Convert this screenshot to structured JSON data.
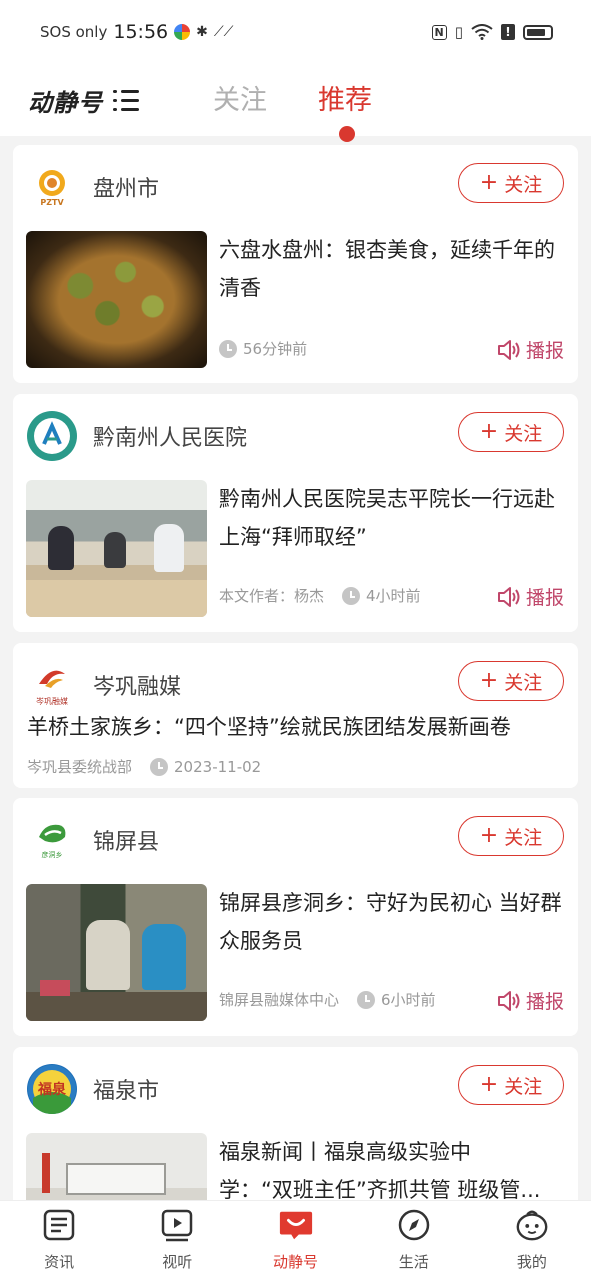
{
  "status_bar": {
    "carrier": "SOS only",
    "time": "15:56",
    "right_icons": [
      "nfc-icon",
      "vibrate-icon",
      "wifi-icon",
      "alert-icon",
      "battery-icon"
    ]
  },
  "header": {
    "brand": "动静号",
    "tabs": [
      {
        "label": "关注",
        "active": false
      },
      {
        "label": "推荐",
        "active": true
      }
    ]
  },
  "follow_label": "关注",
  "broadcast_label": "播报",
  "cards": [
    {
      "source": "盘州市",
      "title": "六盘水盘州：银杏美食，延续千年的清香",
      "time": "56分钟前",
      "has_broadcast": true
    },
    {
      "source": "黔南州人民医院",
      "title": "黔南州人民医院吴志平院长一行远赴上海“拜师取经”",
      "author": "本文作者：杨杰",
      "time": "4小时前",
      "has_broadcast": true
    },
    {
      "source": "岑巩融媒",
      "title": "羊桥土家族乡：“四个坚持”绘就民族团结发展新画卷",
      "author": "岑巩县委统战部",
      "time": "2023-11-02",
      "has_broadcast": false
    },
    {
      "source": "锦屏县",
      "title": "锦屏县彦洞乡：守好为民初心 当好群众服务员",
      "author": "锦屏县融媒体中心",
      "time": "6小时前",
      "has_broadcast": true
    },
    {
      "source": "福泉市",
      "title_line1": "福泉新闻丨福泉高级实验中",
      "title_line2": "学：“双班主任”齐抓共管 班级管..."
    }
  ],
  "bottom_nav": [
    {
      "label": "资讯",
      "icon": "news-icon",
      "active": false
    },
    {
      "label": "视听",
      "icon": "video-icon",
      "active": false
    },
    {
      "label": "动静号",
      "icon": "dongjing-icon",
      "active": true
    },
    {
      "label": "生活",
      "icon": "compass-icon",
      "active": false
    },
    {
      "label": "我的",
      "icon": "profile-icon",
      "active": false
    }
  ],
  "colors": {
    "accent": "#d9382f",
    "broadcast": "#c0476a",
    "meta_text": "#999999",
    "page_bg": "#f3f3f3"
  }
}
